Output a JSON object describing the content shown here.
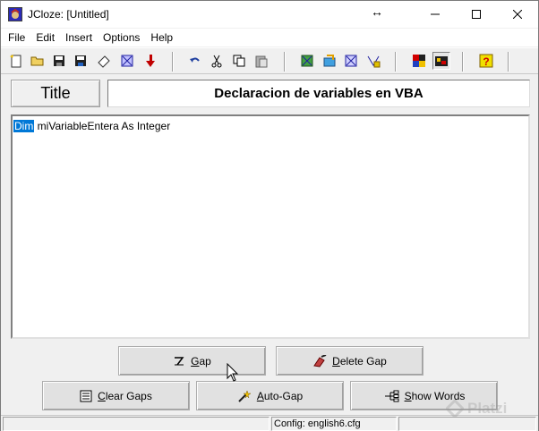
{
  "window": {
    "title": "JCloze: [Untitled]"
  },
  "menu": [
    "File",
    "Edit",
    "Insert",
    "Options",
    "Help"
  ],
  "toolbar": {
    "icons": [
      "new-file-icon",
      "open-folder-icon",
      "save-icon",
      "save-as-icon",
      "clear-icon",
      "web-page-icon",
      "export-arrow-icon",
      "undo-icon",
      "cut-icon",
      "copy-icon",
      "paste-icon",
      "create-web-page-icon",
      "export-drag-drop-icon",
      "web-page-alt-icon",
      "network-export-icon",
      "shuffle-icon",
      "active-tool-icon",
      "help-icon"
    ]
  },
  "title_row": {
    "button_label": "Title",
    "value": "Declaracion de variables en VBA"
  },
  "editor": {
    "selected_text": "Dim",
    "rest_text": " miVariableEntera As Integer"
  },
  "buttons": {
    "gap": {
      "prefix": "",
      "underline": "G",
      "rest": "ap"
    },
    "delete_gap": {
      "prefix": "",
      "underline": "D",
      "rest": "elete Gap"
    },
    "clear_gaps": {
      "prefix": "",
      "underline": "C",
      "rest": "lear Gaps"
    },
    "auto_gap": {
      "prefix": "",
      "underline": "A",
      "rest": "uto-Gap"
    },
    "show_words": {
      "prefix": "",
      "underline": "S",
      "rest": "how Words"
    }
  },
  "statusbar": {
    "config": "Config: english6.cfg"
  },
  "watermark": {
    "text": "Platzi"
  },
  "colors": {
    "selection": "#0078d7",
    "window_bg": "#f0f0f0"
  }
}
